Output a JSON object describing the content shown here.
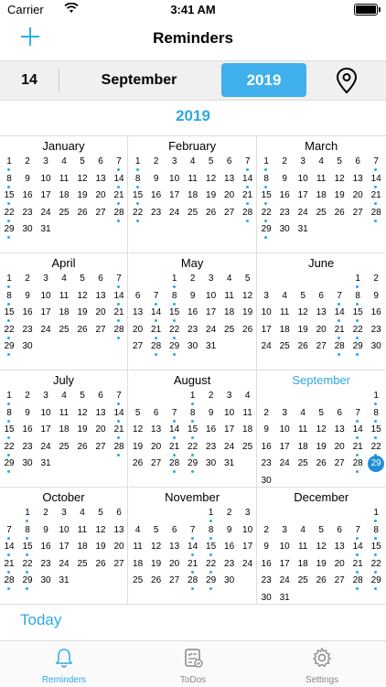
{
  "status": {
    "carrier": "Carrier",
    "time": "3:41 AM"
  },
  "nav": {
    "title": "Reminders"
  },
  "datebar": {
    "day": "14",
    "month": "September",
    "year": "2019"
  },
  "year_label": "2019",
  "today_label": "Today",
  "tabs": [
    {
      "label": "Reminders",
      "icon": "bell-icon",
      "active": true
    },
    {
      "label": "ToDos",
      "icon": "checklist-icon",
      "active": false
    },
    {
      "label": "Settings",
      "icon": "gear-icon",
      "active": false
    }
  ],
  "accent_color": "#2fa8e2",
  "months": [
    {
      "name": "January",
      "start": 0,
      "days": 31,
      "dots": [
        1,
        7,
        8,
        14,
        15,
        21,
        22,
        28,
        29
      ]
    },
    {
      "name": "February",
      "start": 0,
      "days": 28,
      "dots": [
        1,
        7,
        8,
        14,
        15,
        21,
        22,
        28
      ]
    },
    {
      "name": "March",
      "start": 0,
      "days": 31,
      "dots": [
        1,
        7,
        8,
        14,
        15,
        21,
        22,
        28,
        29
      ]
    },
    {
      "name": "April",
      "start": 0,
      "days": 30,
      "dots": [
        1,
        7,
        8,
        14,
        15,
        21,
        22,
        28,
        29
      ]
    },
    {
      "name": "May",
      "start": 2,
      "days": 31,
      "dots": [
        1,
        7,
        8,
        14,
        15,
        21,
        22,
        28,
        29
      ]
    },
    {
      "name": "June",
      "start": 5,
      "days": 30,
      "dots": [
        1,
        7,
        8,
        14,
        15,
        21,
        22,
        28,
        29
      ]
    },
    {
      "name": "July",
      "start": 0,
      "days": 31,
      "dots": [
        1,
        7,
        8,
        14,
        15,
        21,
        22,
        28,
        29
      ]
    },
    {
      "name": "August",
      "start": 3,
      "days": 31,
      "dots": [
        1,
        7,
        8,
        14,
        15,
        21,
        22,
        28,
        29
      ]
    },
    {
      "name": "September",
      "start": 6,
      "days": 30,
      "dots": [
        1,
        7,
        8,
        14,
        15,
        21,
        22,
        28,
        29
      ],
      "current": true,
      "today": 29
    },
    {
      "name": "October",
      "start": 1,
      "days": 31,
      "dots": [
        1,
        7,
        8,
        14,
        15,
        21,
        22,
        28,
        29
      ]
    },
    {
      "name": "November",
      "start": 4,
      "days": 30,
      "dots": [
        1,
        7,
        8,
        14,
        15,
        21,
        22,
        28,
        29
      ]
    },
    {
      "name": "December",
      "start": 6,
      "days": 31,
      "dots": [
        1,
        7,
        8,
        14,
        15,
        21,
        22,
        28,
        29
      ]
    }
  ]
}
